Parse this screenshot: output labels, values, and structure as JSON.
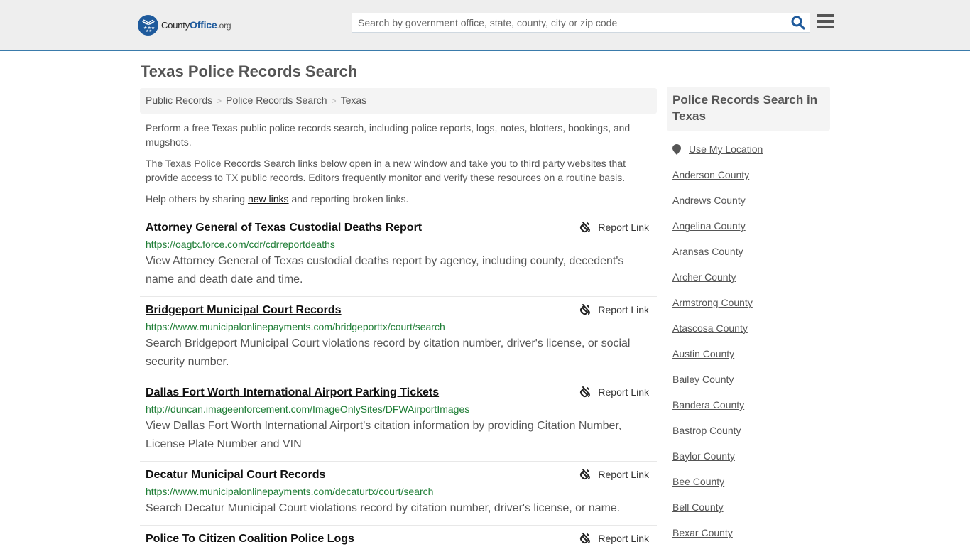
{
  "header": {
    "logo": {
      "name": "County",
      "name_bold": "Office",
      "tld": ".org"
    },
    "search": {
      "placeholder": "Search by government office, state, county, city or zip code",
      "value": ""
    },
    "icons": {
      "search": "search-icon",
      "menu": "hamburger-menu-icon",
      "logo": "eagle-stars-logo-icon"
    },
    "brand_color": "#1e5a9c"
  },
  "page": {
    "title": "Texas Police Records Search",
    "breadcrumb": [
      "Public Records",
      "Police Records Search",
      "Texas"
    ],
    "intro": {
      "p1": "Perform a free Texas public police records search, including police reports, logs, notes, blotters, bookings, and mugshots.",
      "p2": "The Texas Police Records Search links below open in a new window and take you to third party websites that provide access to TX public records. Editors frequently monitor and verify these resources on a routine basis.",
      "p3_before": "Help others by sharing ",
      "p3_link": "new links",
      "p3_after": " and reporting broken links."
    }
  },
  "links": [
    {
      "title": "Attorney General of Texas Custodial Deaths Report",
      "url": "https://oagtx.force.com/cdr/cdrreportdeaths",
      "description": "View Attorney General of Texas custodial deaths report by agency, including county, decedent's name and death date and time.",
      "report_label": "Report Link"
    },
    {
      "title": "Bridgeport Municipal Court Records",
      "url": "https://www.municipalonlinepayments.com/bridgeporttx/court/search",
      "description": "Search Bridgeport Municipal Court violations record by citation number, driver's license, or social security number.",
      "report_label": "Report Link"
    },
    {
      "title": "Dallas Fort Worth International Airport Parking Tickets",
      "url": "http://duncan.imageenforcement.com/ImageOnlySites/DFWAirportImages",
      "description": "View Dallas Fort Worth International Airport's citation information by providing Citation Number, License Plate Number and VIN",
      "report_label": "Report Link"
    },
    {
      "title": "Decatur Municipal Court Records",
      "url": "https://www.municipalonlinepayments.com/decaturtx/court/search",
      "description": "Search Decatur Municipal Court violations record by citation number, driver's license, or name.",
      "report_label": "Report Link"
    },
    {
      "title": "Police To Citizen Coalition Police Logs",
      "url": "",
      "description": "",
      "report_label": "Report Link"
    }
  ],
  "sidebar": {
    "heading": "Police Records Search in Texas",
    "use_location": "Use My Location",
    "counties": [
      "Anderson County",
      "Andrews County",
      "Angelina County",
      "Aransas County",
      "Archer County",
      "Armstrong County",
      "Atascosa County",
      "Austin County",
      "Bailey County",
      "Bandera County",
      "Bastrop County",
      "Baylor County",
      "Bee County",
      "Bell County",
      "Bexar County"
    ]
  }
}
